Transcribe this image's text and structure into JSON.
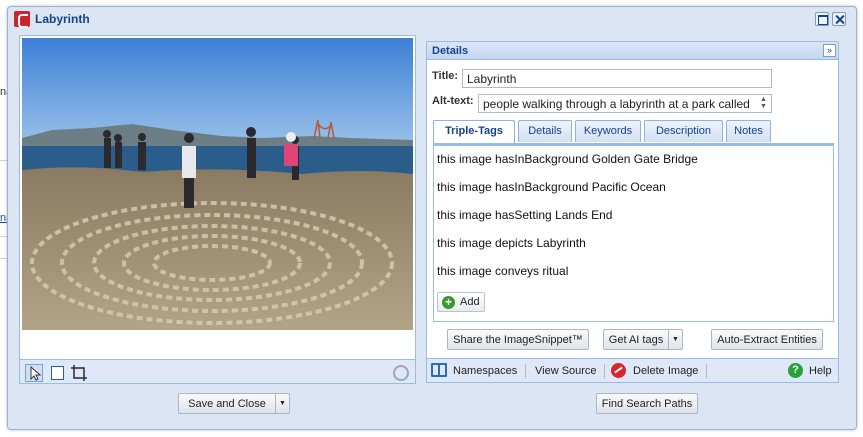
{
  "background": {
    "fragment_1": "na",
    "fragment_2": "na"
  },
  "window": {
    "title": "Labyrinth"
  },
  "details": {
    "header": "Details",
    "collapse_glyph": "»",
    "title_label": "Title:",
    "title_value": "Labyrinth",
    "alt_label": "Alt-text:",
    "alt_value": "people walking through a labyrinth at a park called",
    "tabs": [
      "Triple-Tags",
      "Details",
      "Keywords",
      "Description",
      "Notes"
    ],
    "triple_tags": [
      "this image hasInBackground Golden Gate Bridge",
      "this image hasInBackground Pacific Ocean",
      "this image hasSetting Lands End",
      "this image depicts Labyrinth",
      "this image conveys ritual"
    ],
    "add_label": "Add",
    "share_label": "Share the ImageSnippet™",
    "ai_tags_label": "Get AI tags",
    "auto_extract_label": "Auto-Extract Entities"
  },
  "footer": {
    "namespaces": "Namespaces",
    "view_source": "View Source",
    "delete_image": "Delete Image",
    "help": "Help"
  },
  "bottom_buttons": {
    "save_close": "Save and Close",
    "find_paths": "Find Search Paths"
  },
  "colors": {
    "window_bg": "#dbe5f3",
    "title_text": "#15428b",
    "panel_border": "#99bbe8",
    "delete_red": "#d8262c",
    "help_green": "#27a13a"
  },
  "icons": [
    "app-logo-icon",
    "maximize-icon",
    "close-icon",
    "pointer-tool-icon",
    "rectangle-tool-icon",
    "crop-tool-icon",
    "help-circle-icon",
    "book-icon",
    "delete-icon",
    "help-icon",
    "add-icon"
  ]
}
